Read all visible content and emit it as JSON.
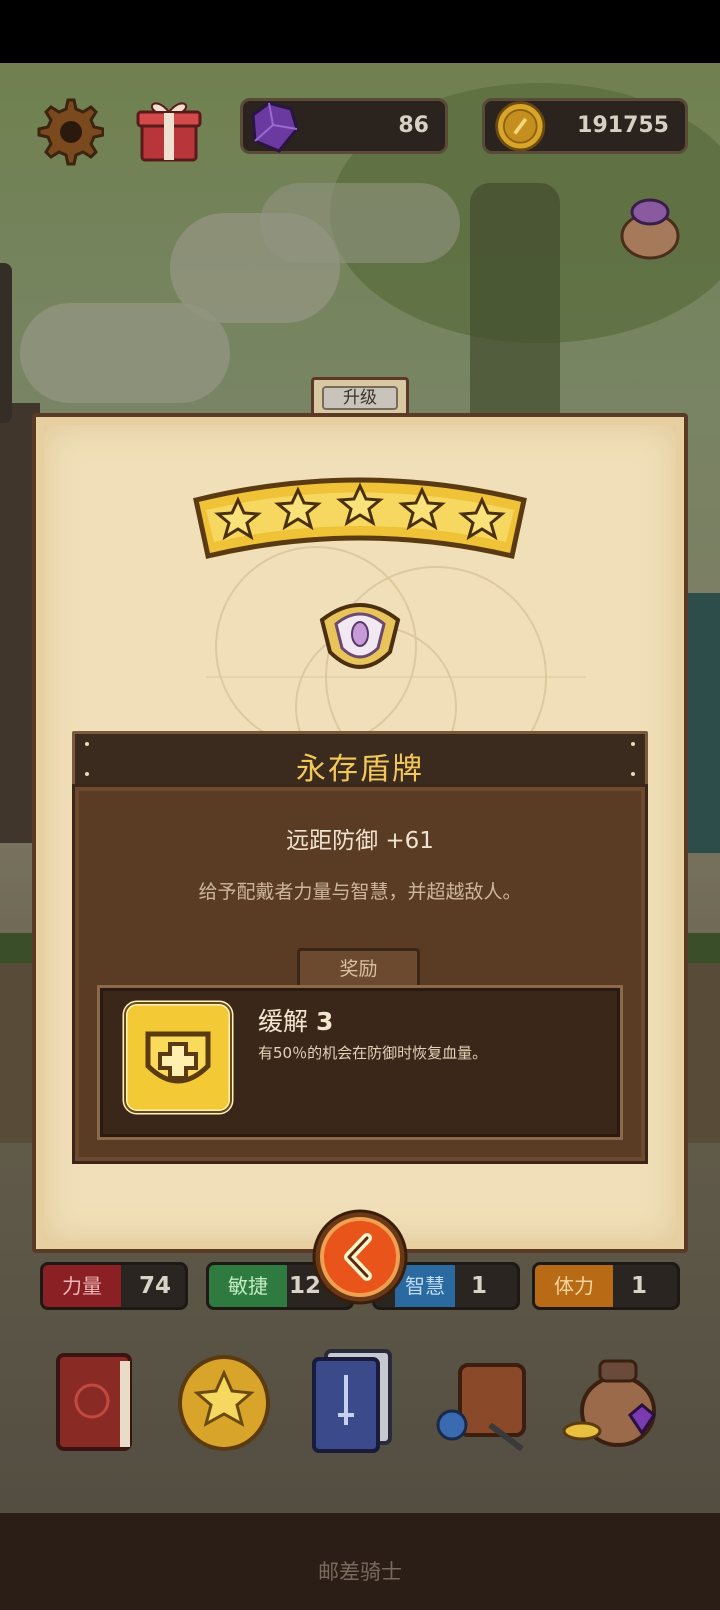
{
  "currency": {
    "gems": "86",
    "coins": "191755"
  },
  "dialog": {
    "tab_label": "升级",
    "stars": 5,
    "item_name": "永存盾牌",
    "stat_line": "远距防御 +61",
    "flavor": "给予配戴者力量与智慧，并超越敌人。",
    "reward_tab": "奖励",
    "reward_title": "缓解",
    "reward_level": "3",
    "reward_desc": "有50％的机会在防御时恢复血量。"
  },
  "attributes": [
    {
      "label": "力量",
      "value": "74",
      "color": "#8a1f24"
    },
    {
      "label": "敏捷",
      "value": "12",
      "color": "#2f7a3f"
    },
    {
      "label": "智慧",
      "value": "1",
      "color": "#2a6aa0"
    },
    {
      "label": "体力",
      "value": "1",
      "color": "#b86a14"
    }
  ],
  "menu_icons": [
    "book-icon",
    "star-coin-icon",
    "card-deck-icon",
    "backpack-icon",
    "treasure-bag-icon"
  ],
  "footer": {
    "title": "邮差骑士"
  }
}
